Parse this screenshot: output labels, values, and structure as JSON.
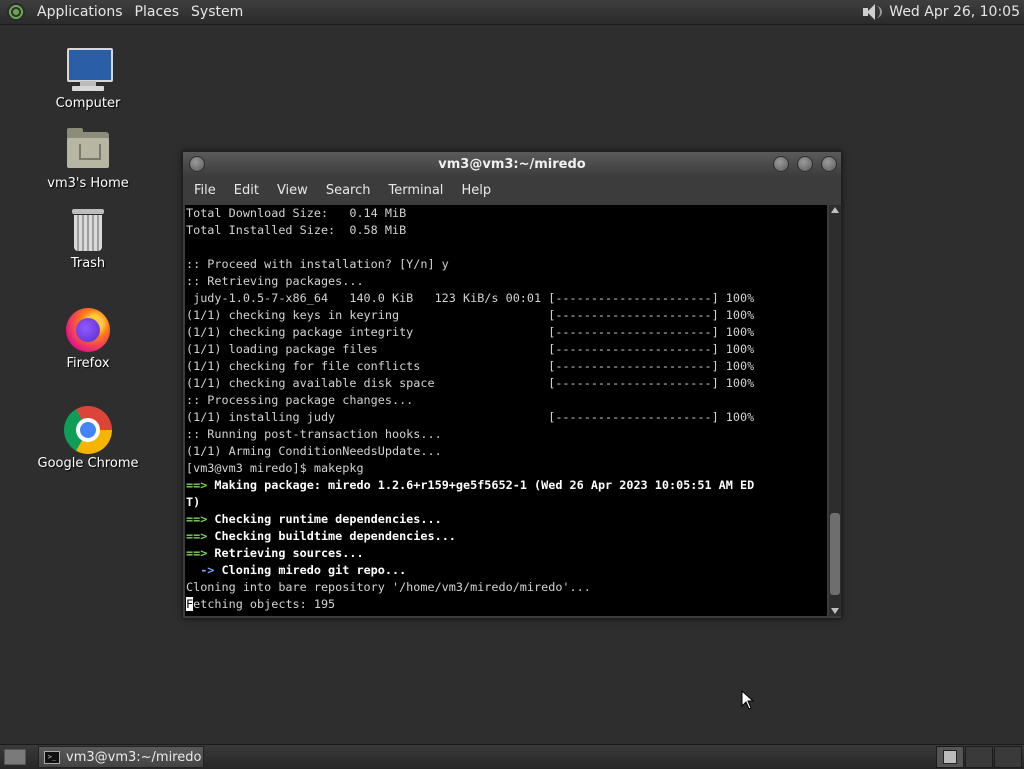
{
  "top_panel": {
    "menus": [
      "Applications",
      "Places",
      "System"
    ],
    "clock": "Wed Apr 26, 10:05"
  },
  "desktop_icons": [
    {
      "label": "Computer",
      "icon": "computer-icon"
    },
    {
      "label": "vm3's Home",
      "icon": "home-folder-icon"
    },
    {
      "label": "Trash",
      "icon": "trash-icon"
    },
    {
      "label": "Firefox",
      "icon": "firefox-icon"
    },
    {
      "label": "Google Chrome",
      "icon": "chrome-icon"
    }
  ],
  "terminal": {
    "title": "vm3@vm3:~/miredo",
    "menu": [
      "File",
      "Edit",
      "View",
      "Search",
      "Terminal",
      "Help"
    ],
    "lines": [
      "Total Download Size:   0.14 MiB",
      "Total Installed Size:  0.58 MiB",
      "",
      ":: Proceed with installation? [Y/n] y",
      ":: Retrieving packages...",
      " judy-1.0.5-7-x86_64   140.0 KiB   123 KiB/s 00:01 [----------------------] 100%",
      "(1/1) checking keys in keyring                     [----------------------] 100%",
      "(1/1) checking package integrity                   [----------------------] 100%",
      "(1/1) loading package files                        [----------------------] 100%",
      "(1/1) checking for file conflicts                  [----------------------] 100%",
      "(1/1) checking available disk space                [----------------------] 100%",
      ":: Processing package changes...",
      "(1/1) installing judy                              [----------------------] 100%",
      ":: Running post-transaction hooks...",
      "(1/1) Arming ConditionNeedsUpdate...",
      "[vm3@vm3 miredo]$ makepkg"
    ],
    "styled_lines": [
      {
        "prefix": "==>",
        "prefix_color": "green",
        "text": " Making package: miredo 1.2.6+r159+ge5f5652-1 (Wed 26 Apr 2023 10:05:51 AM ED"
      },
      {
        "prefix": "",
        "prefix_color": "none",
        "text": "T)"
      },
      {
        "prefix": "==>",
        "prefix_color": "green",
        "text": " Checking runtime dependencies..."
      },
      {
        "prefix": "==>",
        "prefix_color": "green",
        "text": " Checking buildtime dependencies..."
      },
      {
        "prefix": "==>",
        "prefix_color": "green",
        "text": " Retrieving sources..."
      },
      {
        "prefix": "  ->",
        "prefix_color": "blue",
        "text": " Cloning miredo git repo..."
      }
    ],
    "tail_lines": [
      "Cloning into bare repository '/home/vm3/miredo/miredo'..."
    ],
    "cursor_char": "F",
    "last_line_rest": "etching objects: 195"
  },
  "taskbar": {
    "window_button": "vm3@vm3:~/miredo",
    "window_icon_text": ">_"
  }
}
